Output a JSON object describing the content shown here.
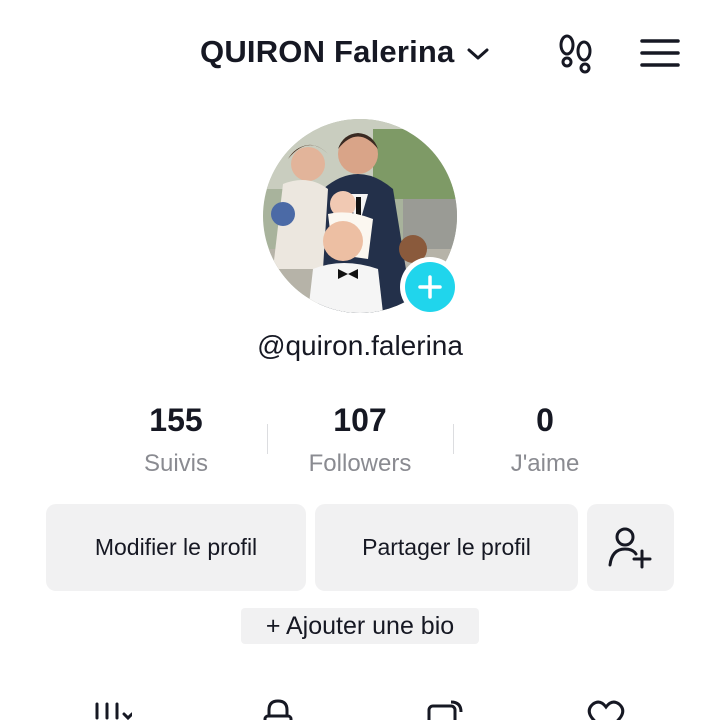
{
  "header": {
    "title": "QUIRON Falerina",
    "icons": [
      "chevron-down-icon",
      "footprints-icon",
      "hamburger-menu-icon"
    ]
  },
  "profile": {
    "username": "@quiron.falerina",
    "avatar": "family-photo",
    "add_icon": "plus-icon"
  },
  "stats": [
    {
      "value": "155",
      "label": "Suivis"
    },
    {
      "value": "107",
      "label": "Followers"
    },
    {
      "value": "0",
      "label": "J'aime"
    }
  ],
  "actions": {
    "edit_profile": "Modifier le profil",
    "share_profile": "Partager le profil",
    "add_friend_icon": "add-user-icon"
  },
  "bio_button": "+ Ajouter une bio",
  "tabs": [
    "videos-grid-icon",
    "lock-icon",
    "repost-icon",
    "liked-heart-icon"
  ],
  "colors": {
    "accent": "#20d5ec",
    "button_bg": "#f1f1f2",
    "secondary_text": "#8a8b91",
    "primary_text": "#161823"
  }
}
